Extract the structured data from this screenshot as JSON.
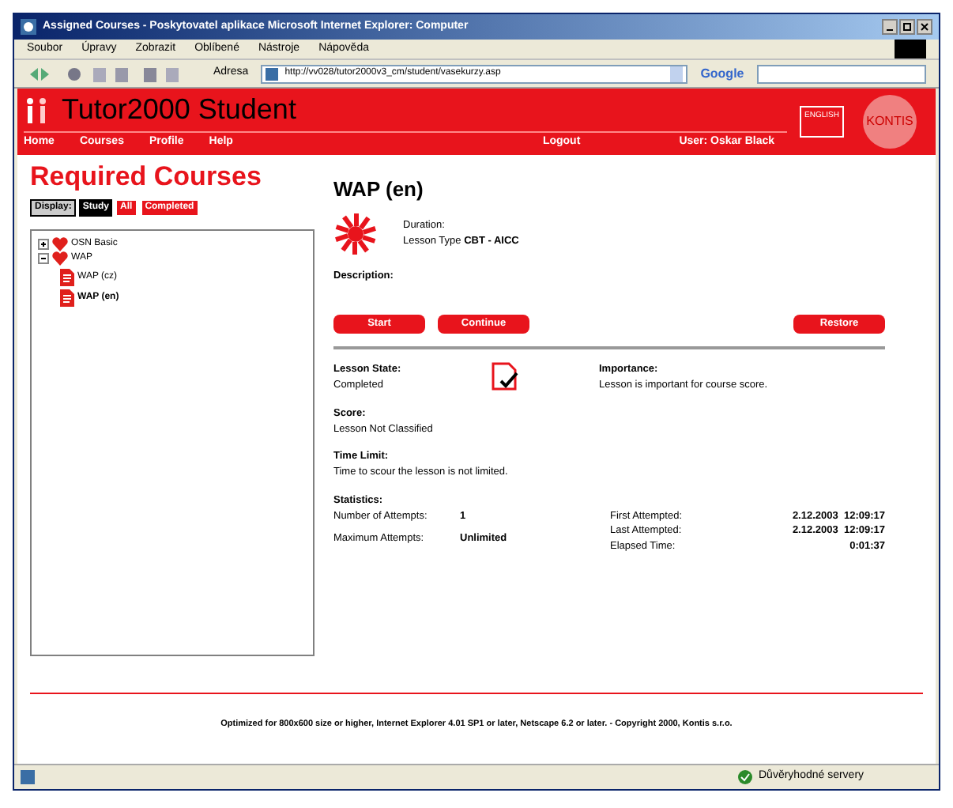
{
  "window": {
    "title": "Assigned Courses - Poskytovatel aplikace Microsoft Internet Explorer: Computer"
  },
  "menu": [
    "Soubor",
    "Úpravy",
    "Zobrazit",
    "Oblíbené",
    "Nástroje",
    "Nápověda"
  ],
  "address": {
    "label": "Adresa",
    "value": "http://vv028/tutor2000v3_cm/student/vasekurzy.asp"
  },
  "search_logo": "Google",
  "header": {
    "title": "Tutor2000 Student",
    "nav": [
      "Home",
      "Courses",
      "Profile",
      "Help"
    ],
    "logout": "Logout",
    "user": "User: Oskar Black",
    "badge": "ENGLISH",
    "logo": "KONTIS"
  },
  "page_title": "Required Courses",
  "filter": {
    "label": "Display:",
    "options": [
      {
        "label": "Study",
        "selected": true
      },
      {
        "label": "All",
        "selected": false
      },
      {
        "label": "Completed",
        "selected": false
      }
    ]
  },
  "tree": [
    {
      "label": "OSN Basic",
      "expanded": false,
      "selected": false
    },
    {
      "label": "WAP",
      "expanded": true,
      "selected": false,
      "children": [
        {
          "label": "WAP (cz)",
          "selected": false
        },
        {
          "label": "WAP (en)",
          "selected": true
        }
      ]
    }
  ],
  "lesson": {
    "title": "WAP (en)",
    "duration_label": "Duration:",
    "type_label": "Lesson Type",
    "type_value": "CBT - AICC",
    "description_label": "Description:"
  },
  "buttons": [
    {
      "label": "Start"
    },
    {
      "label": "Continue"
    },
    {
      "label": "Restore"
    }
  ],
  "state": {
    "label": "Lesson State:",
    "value": "Completed"
  },
  "importance": {
    "label": "Importance:",
    "value": "Lesson is important for course score."
  },
  "score": {
    "label": "Score:",
    "value": "Lesson Not Classified"
  },
  "time_limit": {
    "label": "Time Limit:",
    "value": "Time to scour the lesson is not limited."
  },
  "statistics": {
    "label": "Statistics:",
    "left": [
      {
        "label": "Number of Attempts:",
        "value": "1"
      },
      {
        "label": "Maximum Attempts:",
        "value": "Unlimited"
      }
    ],
    "right": [
      {
        "label": "First Attempted:",
        "value": "2.12.2003  12:09:17"
      },
      {
        "label": "Last Attempted:",
        "value": "2.12.2003  12:09:17"
      },
      {
        "label": "Elapsed Time:",
        "value": "0:01:37"
      }
    ]
  },
  "footer": "Optimized for 800x600 size or higher, Internet Explorer 4.01 SP1 or later, Netscape 6.2 or later. - Copyright 2000, Kontis s.r.o.",
  "status_bar": {
    "zone": "Důvěryhodné servery"
  }
}
